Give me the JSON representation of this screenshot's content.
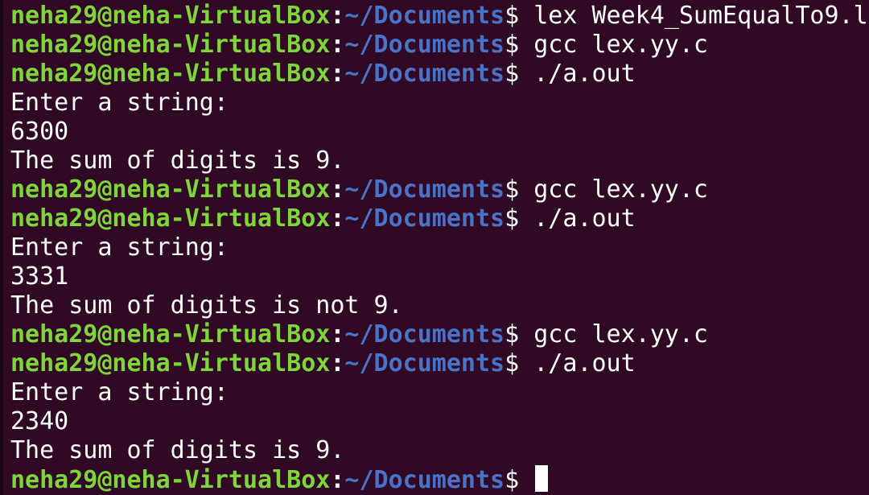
{
  "terminal": {
    "user_host": "neha29@neha-VirtualBox",
    "colon": ":",
    "path": "~/Documents",
    "dollar": "$ ",
    "colors": {
      "background": "#300a24",
      "prompt_user": "#7fd63a",
      "prompt_path": "#4a73c8",
      "text": "#ffffff"
    },
    "lines": [
      {
        "type": "prompt",
        "command": "lex Week4_SumEqualTo9.l"
      },
      {
        "type": "prompt",
        "command": "gcc lex.yy.c"
      },
      {
        "type": "prompt",
        "command": "./a.out"
      },
      {
        "type": "output",
        "text": "Enter a string:"
      },
      {
        "type": "output",
        "text": "6300"
      },
      {
        "type": "output",
        "text": "The sum of digits is 9."
      },
      {
        "type": "prompt",
        "command": "gcc lex.yy.c"
      },
      {
        "type": "prompt",
        "command": "./a.out"
      },
      {
        "type": "output",
        "text": "Enter a string:"
      },
      {
        "type": "output",
        "text": "3331"
      },
      {
        "type": "output",
        "text": "The sum of digits is not 9."
      },
      {
        "type": "prompt",
        "command": "gcc lex.yy.c"
      },
      {
        "type": "prompt",
        "command": "./a.out"
      },
      {
        "type": "output",
        "text": "Enter a string:"
      },
      {
        "type": "output",
        "text": "2340"
      },
      {
        "type": "output",
        "text": "The sum of digits is 9."
      },
      {
        "type": "prompt",
        "command": ""
      }
    ]
  }
}
